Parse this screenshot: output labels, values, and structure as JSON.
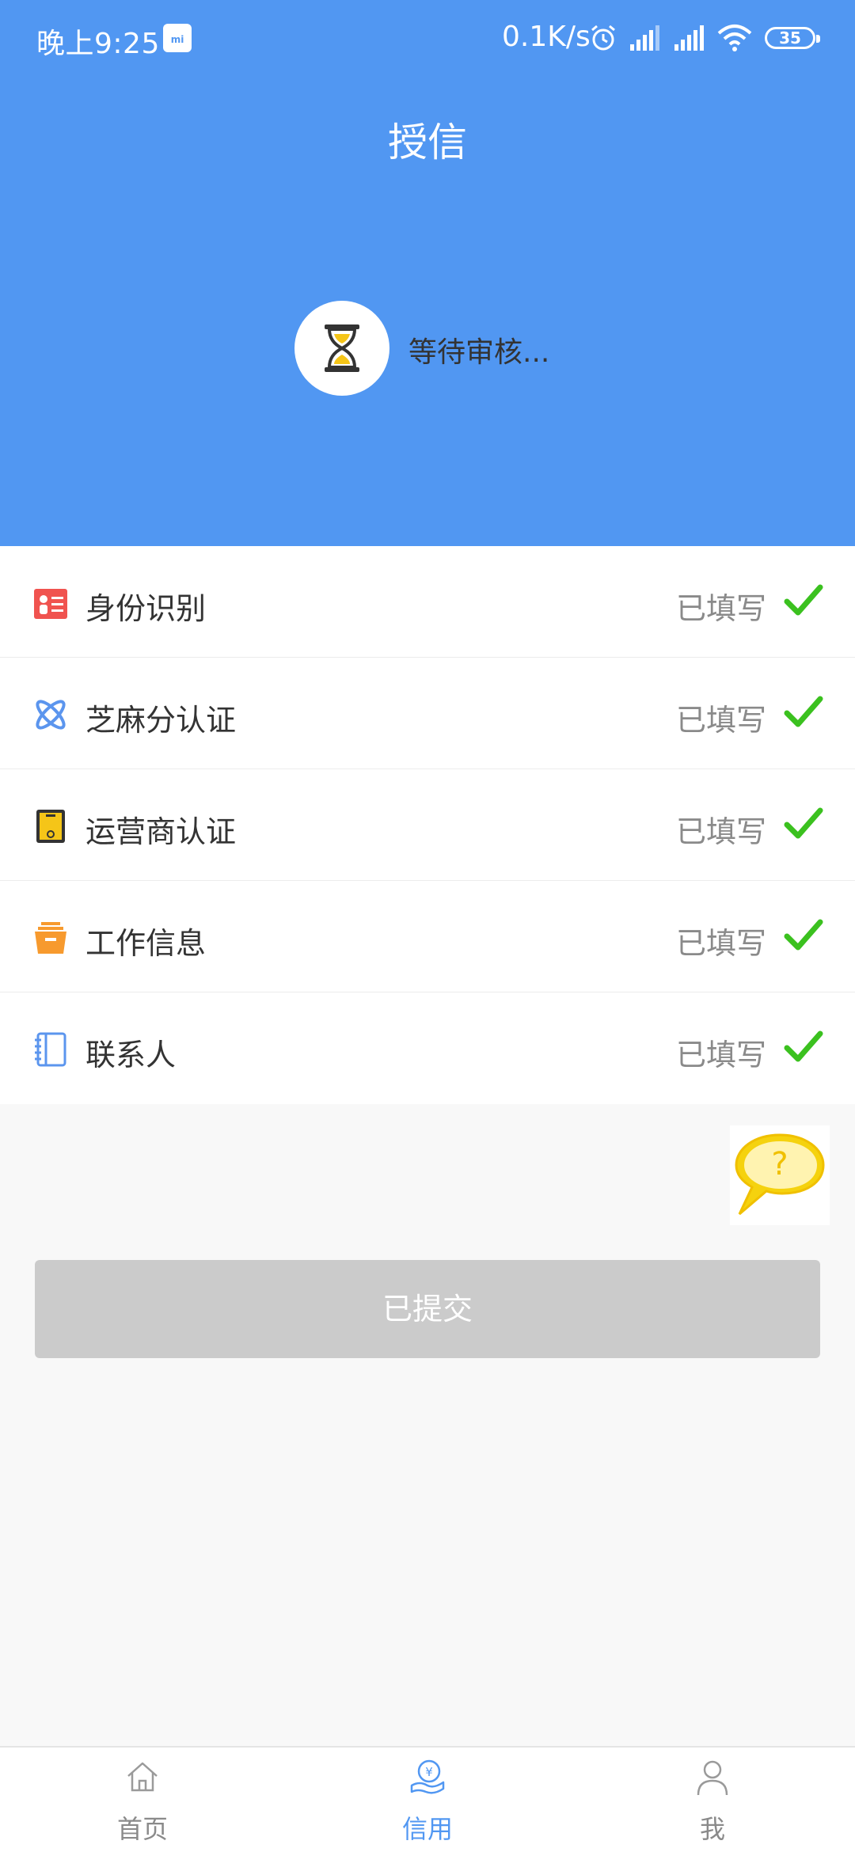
{
  "status_bar": {
    "time": "晚上9:25",
    "mi_badge": "mi",
    "net_speed": "0.1K/s",
    "battery": "35"
  },
  "header": {
    "title": "授信",
    "status_text": "等待审核...",
    "bg_color": "#5197f2"
  },
  "items": [
    {
      "label": "身份识别",
      "status": "已填写",
      "icon": "id-card-icon",
      "icon_color": "#f0534f"
    },
    {
      "label": "芝麻分认证",
      "status": "已填写",
      "icon": "sesame-icon",
      "icon_color": "#5b95ee"
    },
    {
      "label": "运营商认证",
      "status": "已填写",
      "icon": "phone-icon",
      "icon_color": "#f5c518"
    },
    {
      "label": "工作信息",
      "status": "已填写",
      "icon": "briefcase-icon",
      "icon_color": "#f79a2e"
    },
    {
      "label": "联系人",
      "status": "已填写",
      "icon": "address-book-icon",
      "icon_color": "#5b95ee"
    }
  ],
  "check_color": "#3bc11f",
  "submit": {
    "label": "已提交"
  },
  "tabbar": {
    "tabs": [
      {
        "label": "首页",
        "icon": "home-icon",
        "active": false
      },
      {
        "label": "信用",
        "icon": "credit-icon",
        "active": true
      },
      {
        "label": "我",
        "icon": "user-icon",
        "active": false
      }
    ]
  }
}
